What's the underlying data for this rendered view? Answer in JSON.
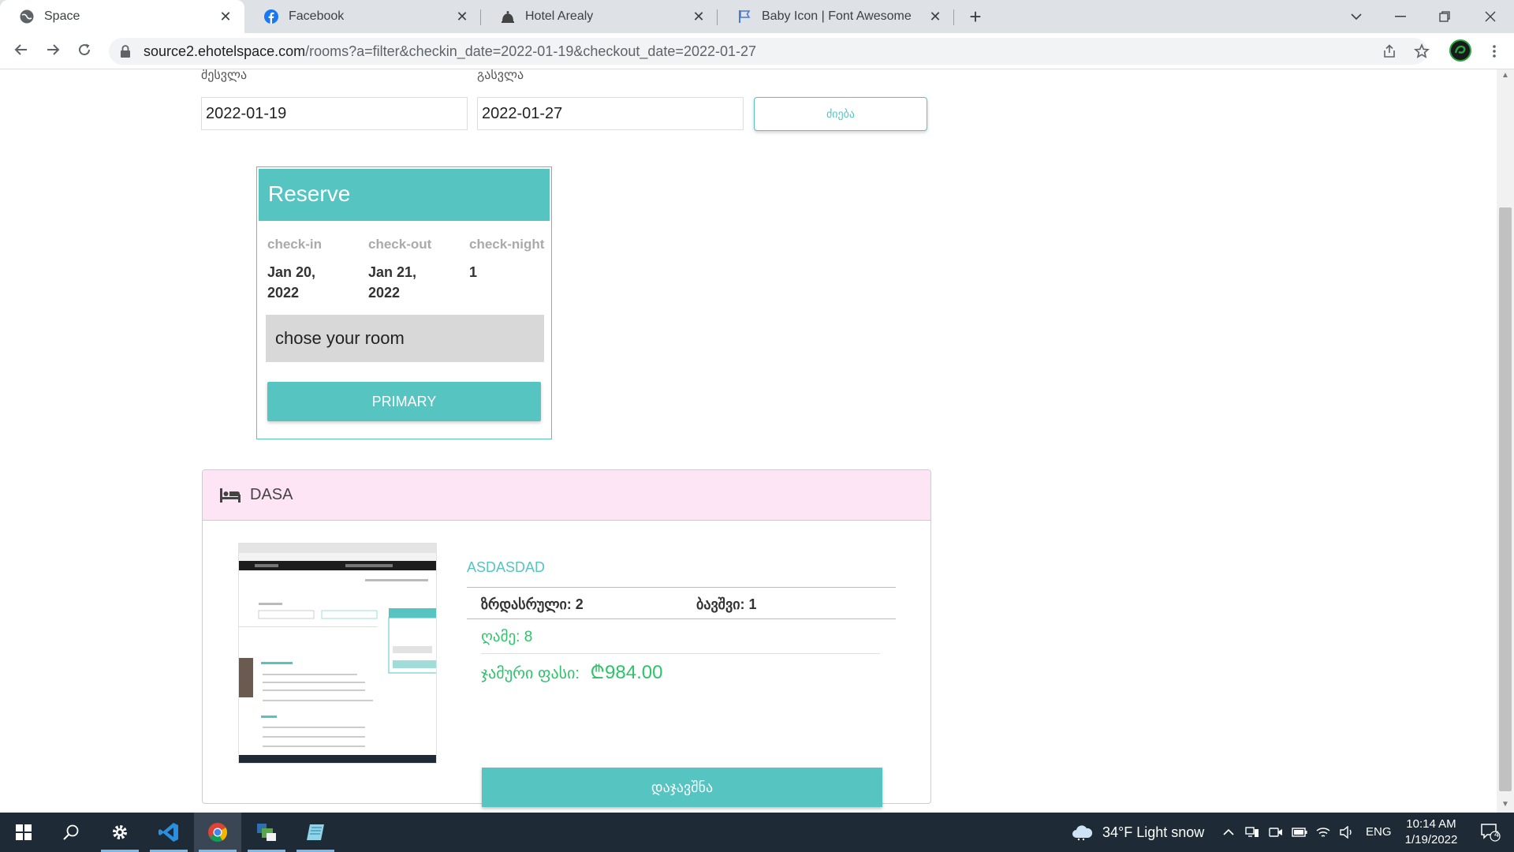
{
  "browser": {
    "tabs": [
      {
        "title": "Space",
        "icon": "globe-icon",
        "active": true
      },
      {
        "title": "Facebook",
        "icon": "facebook-icon",
        "active": false
      },
      {
        "title": "Hotel Arealy",
        "icon": "bell-icon",
        "active": false
      },
      {
        "title": "Baby Icon | Font Awesome",
        "icon": "flag-icon",
        "active": false
      }
    ],
    "url_host": "source2.ehotelspace.com",
    "url_rest": "/rooms?a=filter&checkin_date=2022-01-19&checkout_date=2022-01-27"
  },
  "search_form": {
    "checkin_label": "შესვლა",
    "checkout_label": "გასვლა",
    "checkin_value": "2022-01-19",
    "checkout_value": "2022-01-27",
    "search_button": "ძიება"
  },
  "reserve": {
    "title": "Reserve",
    "checkin_header": "check-in",
    "checkout_header": "check-out",
    "nights_header": "check-night",
    "checkin_line1": "Jan 20,",
    "checkin_line2": "2022",
    "checkout_line1": "Jan 21,",
    "checkout_line2": "2022",
    "nights_value": "1",
    "room_placeholder": "chose your room",
    "primary_button": "PRIMARY"
  },
  "room": {
    "category": "DASA",
    "name": "ASDASDAD",
    "adults": "ზრდასრული: 2",
    "children": "ბავშვი: 1",
    "nights": "ღამე: 8",
    "total_label": "ჯამური ფასი:",
    "total_price": "₾984.00",
    "book_button": "დაჯავშნა"
  },
  "taskbar": {
    "weather": "34°F  Light snow",
    "language": "ENG",
    "time": "10:14 AM",
    "date": "1/19/2022",
    "notifications": "4"
  },
  "colors": {
    "accent": "#56c4c0",
    "room_header_bg": "#fde5f6",
    "price_green": "#2ec36a",
    "taskbar": "#1e2b36"
  }
}
